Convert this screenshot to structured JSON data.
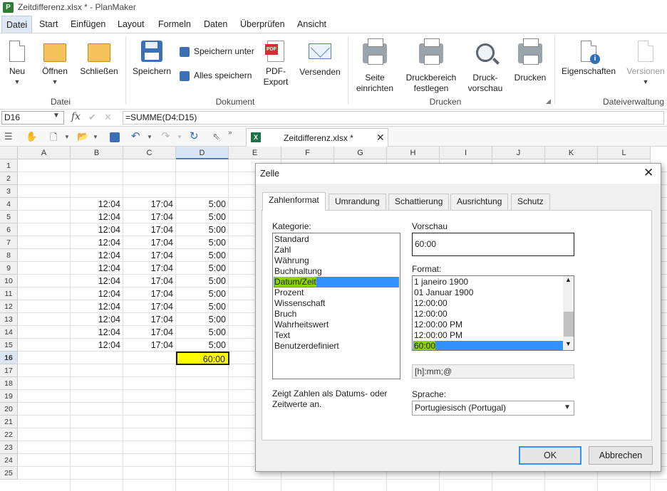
{
  "window": {
    "title": "Zeitdifferenz.xlsx * - PlanMaker",
    "app_icon": "P"
  },
  "menu": {
    "tabs": [
      "Datei",
      "Start",
      "Einfügen",
      "Layout",
      "Formeln",
      "Daten",
      "Überprüfen",
      "Ansicht"
    ],
    "active": "Datei"
  },
  "ribbon": {
    "datei": {
      "group": "Datei",
      "neu": "Neu",
      "oeffnen": "Öffnen",
      "schliessen": "Schließen"
    },
    "dokument": {
      "group": "Dokument",
      "speichern": "Speichern",
      "speichern_unter": "Speichern unter",
      "alles_speichern": "Alles speichern",
      "pdf_line1": "PDF-",
      "pdf_line2": "Export",
      "versenden": "Versenden"
    },
    "drucken": {
      "group": "Drucken",
      "seite1": "Seite",
      "seite2": "einrichten",
      "bereich1": "Druckbereich",
      "bereich2": "festlegen",
      "vorschau1": "Druck-",
      "vorschau2": "vorschau",
      "drucken": "Drucken"
    },
    "verwaltung": {
      "group": "Dateiverwaltung",
      "eigenschaften": "Eigenschaften",
      "versionen": "Versionen"
    }
  },
  "formula_bar": {
    "cell_ref": "D16",
    "formula": "=SUMME(D4:D15)"
  },
  "doc_tab": {
    "name": "Zeitdifferenz.xlsx *"
  },
  "sheet": {
    "columns": [
      "A",
      "B",
      "C",
      "D",
      "E",
      "F",
      "G",
      "H",
      "I",
      "J",
      "K",
      "L"
    ],
    "selected_column": "D",
    "rows": [
      "1",
      "2",
      "3",
      "4",
      "5",
      "6",
      "7",
      "8",
      "9",
      "10",
      "11",
      "12",
      "13",
      "14",
      "15",
      "16",
      "17",
      "18",
      "19",
      "20",
      "21",
      "22",
      "23",
      "24",
      "25"
    ],
    "selected_row": "16",
    "col_b": "12:04",
    "col_c": "17:04",
    "col_d": "5:00",
    "sum_value": "60:00"
  },
  "dialog": {
    "title": "Zelle",
    "tabs": [
      "Zahlenformat",
      "Umrandung",
      "Schattierung",
      "Ausrichtung",
      "Schutz"
    ],
    "active_tab": "Zahlenformat",
    "kategorie_label": "Kategorie:",
    "categories": [
      "Standard",
      "Zahl",
      "Währung",
      "Buchhaltung",
      "Datum/Zeit",
      "Prozent",
      "Wissenschaft",
      "Bruch",
      "Wahrheitswert",
      "Text",
      "Benutzerdefiniert"
    ],
    "selected_category": "Datum/Zeit",
    "description": "Zeigt Zahlen als Datums- oder Zeitwerte an.",
    "vorschau_label": "Vorschau",
    "preview_value": "60:00",
    "format_label": "Format:",
    "formats": [
      "1 janeiro 1900",
      "01 Januar 1900",
      "12:00:00",
      "12:00:00",
      "12:00:00 PM",
      "12:00:00 PM",
      "60:00"
    ],
    "selected_format": "60:00",
    "format_code": "[h]:mm;@",
    "sprache_label": "Sprache:",
    "language": "Portugiesisch (Portugal)",
    "ok": "OK",
    "cancel": "Abbrechen"
  },
  "colors": {
    "accent": "#3390ff",
    "highlight": "#8fd400",
    "selected_cell": "#ffff00"
  }
}
